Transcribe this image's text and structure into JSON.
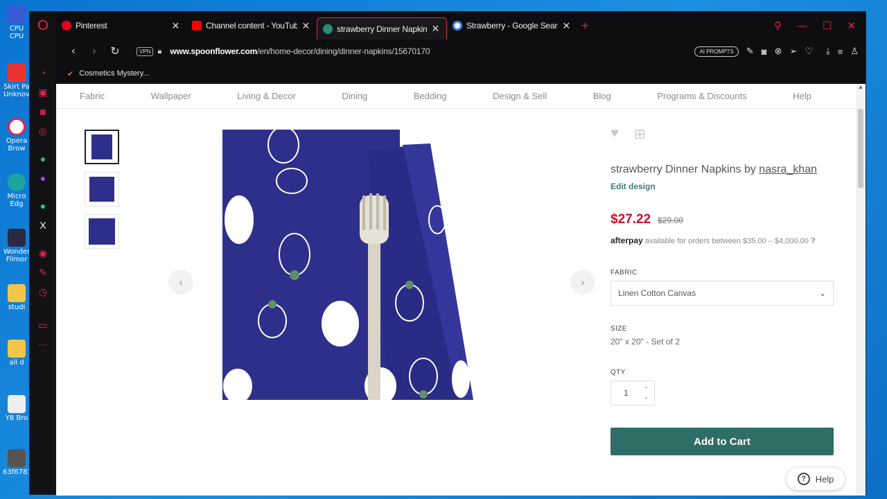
{
  "desktop": {
    "icons": [
      {
        "label": "CPU CPU"
      },
      {
        "label": "Skirt Pa Unknov"
      },
      {
        "label": "Opera Brow"
      },
      {
        "label": "Micro Edg"
      },
      {
        "label": "Wonder Filmor"
      },
      {
        "label": "studi"
      },
      {
        "label": "all d"
      },
      {
        "label": "Y8 Bro"
      },
      {
        "label": "63f6781"
      }
    ]
  },
  "browser": {
    "tabs": [
      {
        "title": "Pinterest",
        "favicon_color": "#e60023"
      },
      {
        "title": "Channel content - YouTube",
        "favicon_color": "#ff0000"
      },
      {
        "title": "strawberry Dinner Napkins",
        "favicon_color": "#2e8b7a"
      },
      {
        "title": "Strawberry - Google Search",
        "favicon_color": "#4285f4"
      }
    ],
    "new_tab": "+",
    "address": {
      "vpn": "VPN",
      "url_domain": "www.spoonflower.com",
      "url_path": "/en/home-decor/dining/dinner-napkins/15670170"
    },
    "ai_prompts": "AI PROMPTS",
    "bookmark": "Cosmetics Mystery...",
    "accent": "#e0244b"
  },
  "site": {
    "nav": [
      "Fabric",
      "Wallpaper",
      "Living & Decor",
      "Dining",
      "Bedding",
      "Design & Sell",
      "Blog",
      "Programs & Discounts",
      "Help"
    ],
    "product": {
      "title_prefix": "strawberry Dinner Napkins by ",
      "designer": "nasra_khan",
      "edit_link": "Edit design",
      "price": "$27.22",
      "old_price": "$29.00",
      "afterpay_brand": "afterpay",
      "afterpay_text": "available for orders between $35.00 – $4,000.00",
      "fabric_label": "FABRIC",
      "fabric_value": "Linen Cotton Canvas",
      "size_label": "SIZE",
      "size_value": "20\" x 20\" - Set of 2",
      "qty_label": "QTY",
      "qty_value": "1",
      "add_to_cart": "Add to Cart",
      "help": "Help"
    },
    "brand_color": "#2f6e66",
    "price_color": "#c8102e",
    "napkin_color": "#2e2f8a"
  }
}
